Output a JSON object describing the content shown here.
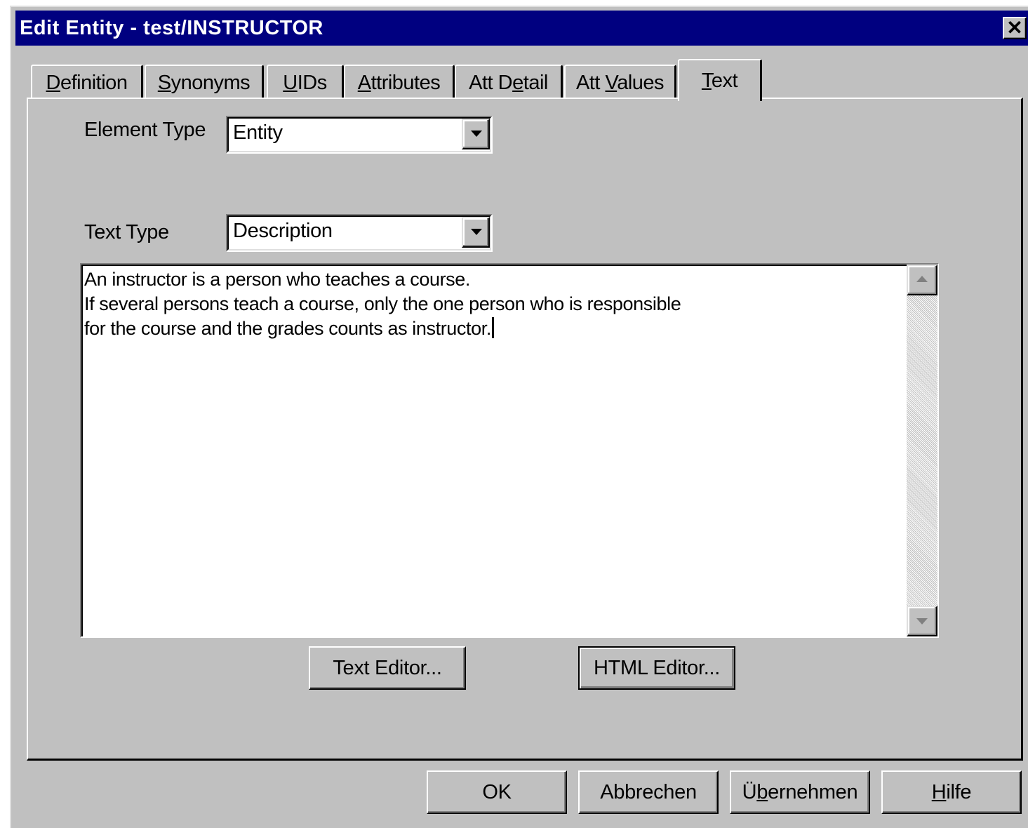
{
  "window": {
    "title": "Edit Entity - test/INSTRUCTOR",
    "close_glyph": "✕"
  },
  "tabs": [
    {
      "label": "Definition",
      "mnemonic_index": 0,
      "active": false
    },
    {
      "label": "Synonyms",
      "mnemonic_index": 0,
      "active": false
    },
    {
      "label": "UIDs",
      "mnemonic_index": 0,
      "active": false
    },
    {
      "label": "Attributes",
      "mnemonic_index": 0,
      "active": false
    },
    {
      "label": "Att Detail",
      "mnemonic_index": 5,
      "active": false
    },
    {
      "label": "Att Values",
      "mnemonic_index": 4,
      "active": false
    },
    {
      "label": "Text",
      "mnemonic_index": 0,
      "active": true
    }
  ],
  "form": {
    "element_type_label": "Element Type",
    "element_type_value": "Entity",
    "text_type_label": "Text Type",
    "text_type_value": "Description",
    "text_body": "An instructor is a person who teaches a course.\nIf several persons teach a course, only the one person who is responsible\nfor the course and the grades counts as instructor."
  },
  "editor_buttons": {
    "text_editor": "Text Editor...",
    "html_editor": "HTML Editor..."
  },
  "dialog_buttons": {
    "ok": "OK",
    "cancel": "Abbrechen",
    "apply": "Übernehmen",
    "apply_mnemonic_index": 1,
    "help": "Hilfe",
    "help_mnemonic_index": 0
  },
  "colors": {
    "titlebar": "#000080",
    "face": "#c0c0c0"
  }
}
